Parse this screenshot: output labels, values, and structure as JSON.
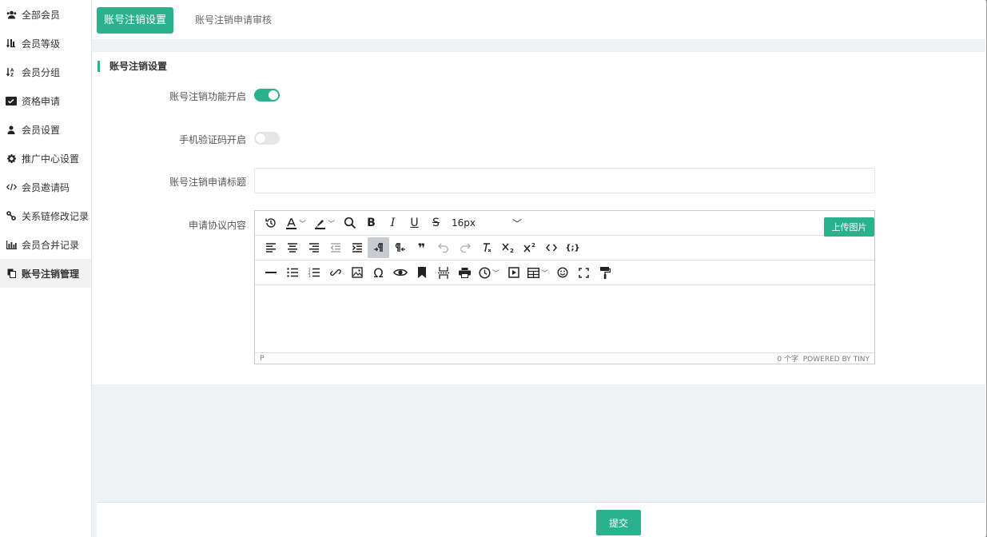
{
  "sidebar": {
    "items": [
      {
        "label": "全部会员",
        "icon": "users-icon"
      },
      {
        "label": "会员等级",
        "icon": "sort-level-icon"
      },
      {
        "label": "会员分组",
        "icon": "sort-alpha-icon"
      },
      {
        "label": "资格申请",
        "icon": "id-card-icon"
      },
      {
        "label": "会员设置",
        "icon": "user-icon"
      },
      {
        "label": "推广中心设置",
        "icon": "gear-icon"
      },
      {
        "label": "会员邀请码",
        "icon": "code-icon"
      },
      {
        "label": "关系链修改记录",
        "icon": "link-icon"
      },
      {
        "label": "会员合并记录",
        "icon": "bar-chart-icon"
      },
      {
        "label": "账号注销管理",
        "icon": "copy-icon"
      }
    ],
    "active_index": 9
  },
  "tabs": {
    "active": "账号注销设置",
    "second": "账号注销申请审核"
  },
  "section": {
    "title": "账号注销设置"
  },
  "form": {
    "cancel_enabled_label": "账号注销功能开启",
    "cancel_enabled": true,
    "sms_label": "手机验证码开启",
    "sms_enabled": false,
    "title_label": "账号注销申请标题",
    "title_value": "",
    "agreement_label": "申请协议内容"
  },
  "editor": {
    "font_size": "16px",
    "upload_label": "上传图片",
    "status_path": "P",
    "word_count": "0 个字",
    "powered_by": "POWERED BY TINY"
  },
  "footer": {
    "submit_label": "提交"
  },
  "colors": {
    "accent": "#2bb18e",
    "background": "#eef2f5"
  }
}
